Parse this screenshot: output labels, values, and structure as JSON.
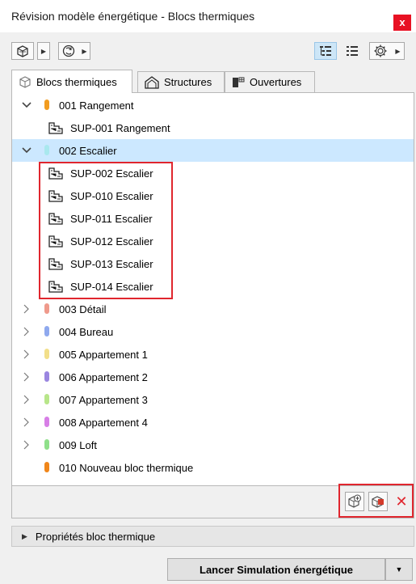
{
  "window": {
    "title": "Révision modèle énergétique - Blocs thermiques",
    "close_label": "x"
  },
  "toolbar": {
    "icons": [
      "model-view-icon",
      "refresh-icon",
      "tree-view-icon",
      "list-view-icon",
      "settings-icon"
    ]
  },
  "tabs": [
    {
      "label": "Blocs thermiques",
      "icon": "thermal-block-icon",
      "selected": true
    },
    {
      "label": "Structures",
      "icon": "structure-icon",
      "selected": false
    },
    {
      "label": "Ouvertures",
      "icon": "openings-icon",
      "selected": false
    }
  ],
  "tree": {
    "rows": [
      {
        "label": "001 Rangement",
        "kind": "block",
        "expanded": true,
        "color": "#f29c1f"
      },
      {
        "label": "SUP-001 Rangement",
        "kind": "zone"
      },
      {
        "label": "002 Escalier",
        "kind": "block",
        "expanded": true,
        "color": "#a9e8ee",
        "highlighted": true
      },
      {
        "label": "SUP-002 Escalier",
        "kind": "zone"
      },
      {
        "label": "SUP-010 Escalier",
        "kind": "zone"
      },
      {
        "label": "SUP-011 Escalier",
        "kind": "zone"
      },
      {
        "label": "SUP-012 Escalier",
        "kind": "zone"
      },
      {
        "label": "SUP-013 Escalier",
        "kind": "zone"
      },
      {
        "label": "SUP-014 Escalier",
        "kind": "zone"
      },
      {
        "label": "003 Détail",
        "kind": "block",
        "expanded": false,
        "color": "#ef9a8c"
      },
      {
        "label": "004 Bureau",
        "kind": "block",
        "expanded": false,
        "color": "#8fa9ee"
      },
      {
        "label": "005 Appartement 1",
        "kind": "block",
        "expanded": false,
        "color": "#f2df8a"
      },
      {
        "label": "006 Appartement 2",
        "kind": "block",
        "expanded": false,
        "color": "#9a86e0"
      },
      {
        "label": "007 Appartement 3",
        "kind": "block",
        "expanded": false,
        "color": "#b8e68a"
      },
      {
        "label": "008 Appartement 4",
        "kind": "block",
        "expanded": false,
        "color": "#d77fe6"
      },
      {
        "label": "009 Loft",
        "kind": "block",
        "expanded": false,
        "color": "#8fe08a"
      },
      {
        "label": "010 Nouveau bloc thermique",
        "kind": "block",
        "expanded": null,
        "color": "#f0861a"
      }
    ]
  },
  "actions": {
    "icons": [
      "add-zone-icon",
      "assign-block-icon",
      "delete-icon"
    ],
    "delete_symbol": "✕"
  },
  "properties": {
    "label": "Propriétés bloc thermique"
  },
  "simulation": {
    "button_label": "Lancer Simulation énergétique"
  },
  "colors": {
    "highlight": "#cce8ff",
    "red_outline": "#e0262e",
    "close_button": "#e81123"
  }
}
